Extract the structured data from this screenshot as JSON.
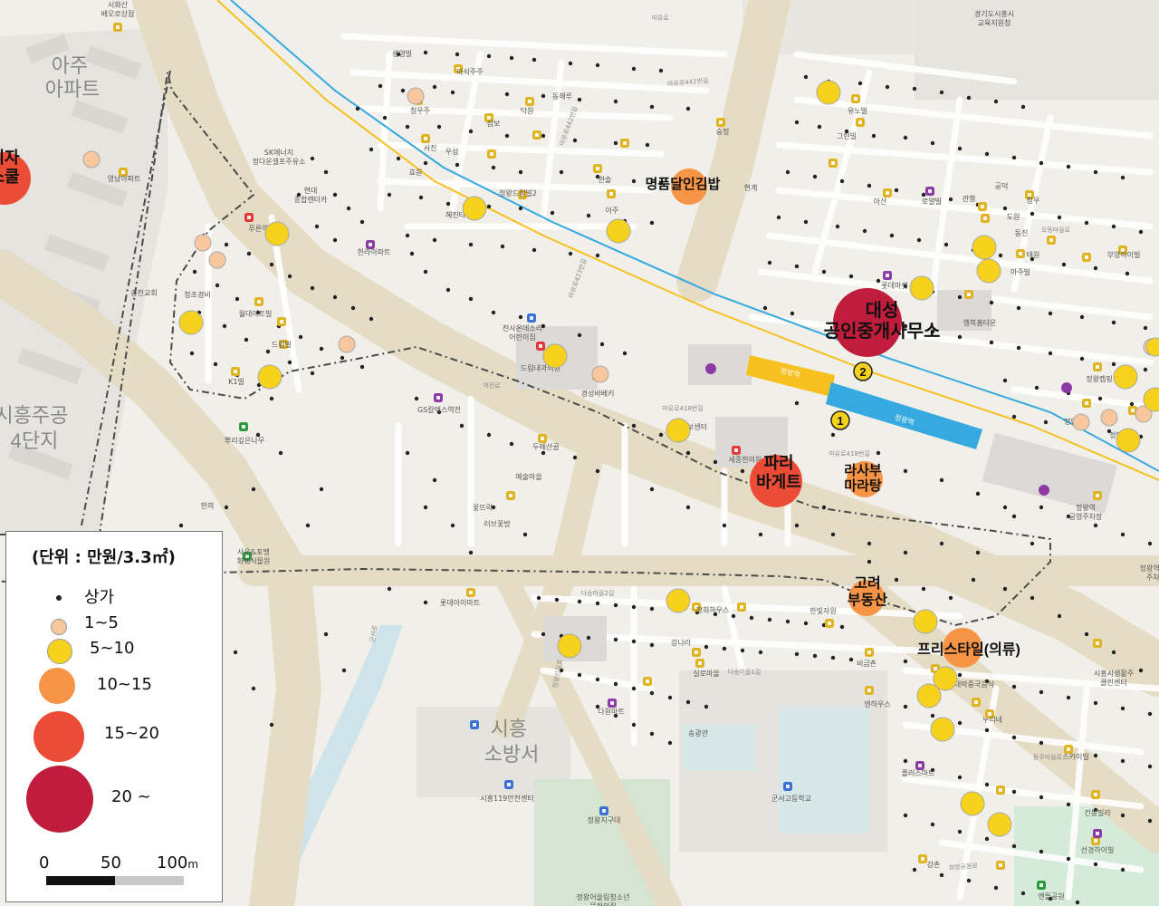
{
  "legend": {
    "title": "(단위 : 만원/3.3㎡)",
    "items": [
      {
        "label": "상가",
        "symbol": "store-dot",
        "color": "#222222"
      },
      {
        "label": "1~5",
        "symbol": "circle-xs",
        "color": "#f9c79d"
      },
      {
        "label": "5~10",
        "symbol": "circle-s",
        "color": "#f7d21c"
      },
      {
        "label": "10~15",
        "symbol": "circle-m",
        "color": "#f79445"
      },
      {
        "label": "15~20",
        "symbol": "circle-l",
        "color": "#ec4c35"
      },
      {
        "label": "20 ~",
        "symbol": "circle-xl",
        "color": "#c01c3b"
      }
    ],
    "scale": {
      "ticks": [
        "0",
        "50",
        "100"
      ],
      "unit": "m"
    }
  },
  "station": {
    "name": "정왕역",
    "exits": [
      "1",
      "2"
    ],
    "line_colors": {
      "suin": "#f6c11e",
      "line4": "#36a9e0"
    }
  },
  "highlights": [
    {
      "label": "대성\n공인중개사무소",
      "class": "20 ~"
    },
    {
      "label": "파리\n바게트",
      "class": "15~20"
    },
    {
      "label": "피자\n스쿨",
      "class": "15~20"
    },
    {
      "label": "명품달인김밥",
      "class": "10~15"
    },
    {
      "label": "라사부\n마라탕",
      "class": "10~15"
    },
    {
      "label": "고려\n부동산",
      "class": "10~15"
    },
    {
      "label": "프리스타일(의류)",
      "class": "10~15"
    }
  ],
  "areas": [
    "아주\n아파트",
    "시흥주공\n4단지",
    "시흥\n소방서"
  ],
  "places": [
    "한라아파트",
    "천사온데소리\n어린이집",
    "드림내과의원",
    "경성바베키",
    "GS칼텍스역전",
    "롯데아이마트",
    "두메산골",
    "예술마을",
    "꽃뜨락",
    "러브꽃방",
    "세종한의원",
    "한국건보센터",
    "뿌리깊은나무",
    "SK에너지\n정다운셀프주유소",
    "청조경비",
    "월대아트빌",
    "드림빌",
    "K1빌",
    "푸른약국",
    "현대\n종합렌터카",
    "송천교회",
    "영남아파트",
    "시화산\n배오로상점",
    "유노빌",
    "그린빌",
    "공덕",
    "아산",
    "로얄빌",
    "롯데마켓",
    "행복홈타운",
    "정왕역\n공영주차장",
    "정왕역공영\n주차장",
    "시흥시생활주\n클린센터",
    "대박중국음식",
    "누리네",
    "스카이빌",
    "건봉빌라",
    "선경하이빌",
    "엔돌공원",
    "강촌",
    "플러스마트",
    "다원마트",
    "실로마을",
    "강나라",
    "장희하우스",
    "한빛자원",
    "비금촌",
    "엔하우스",
    "송광관",
    "군서고등학교",
    "정왕지구대",
    "시흥119안전센터",
    "정왕어울림청소년\n문화의집",
    "사운&포멩\n화훼식물원",
    "한의",
    "경기도시흥시\n교육지원청",
    "생영빌",
    "아삭주주",
    "닥원",
    "동해루",
    "청우주",
    "삼보",
    "서진",
    "효원",
    "우성",
    "정왕드림빌2",
    "혜진타",
    "한솔",
    "아주",
    "현계",
    "숭정",
    "청우",
    "태원",
    "동진",
    "도원",
    "관행",
    "부영하이빌",
    "아주빌",
    "정안팬크",
    "정안빌",
    "정왕캠핑"
  ],
  "road_labels": [
    "마유로",
    "마유로441번길",
    "마유로442번길",
    "마유로423번길",
    "마유로418번길",
    "마유로418번길",
    "역전로",
    "오동마을로",
    "다송마을2길",
    "다송마을1길",
    "정왕신길로",
    "군서로",
    "동주마을로",
    "희망공원로"
  ]
}
